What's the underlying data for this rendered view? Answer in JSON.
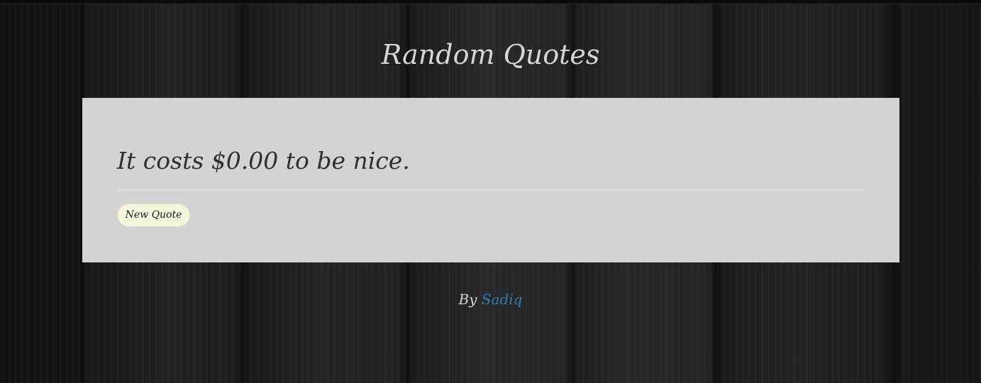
{
  "header": {
    "title": "Random Quotes"
  },
  "quote": {
    "text": "It costs $0.00 to be nice."
  },
  "actions": {
    "new_quote_label": "New Quote"
  },
  "footer": {
    "by_label": "By",
    "author_link": "Sadiq"
  },
  "colors": {
    "card_background": "#d3d3d3",
    "button_background": "#f5f5dc",
    "link": "#337ab7",
    "title_text": "#d6d6d6"
  }
}
